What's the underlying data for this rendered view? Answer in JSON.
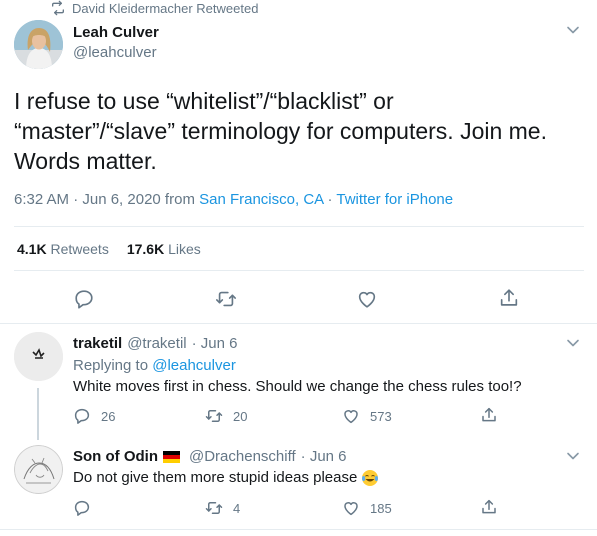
{
  "retweet_header": {
    "text": "David Kleidermacher Retweeted",
    "icon": "retweet-icon"
  },
  "main_tweet": {
    "author_name": "Leah Culver",
    "author_handle": "@leahculver",
    "text_lines": [
      "I refuse to use “whitelist”/“blacklist” or",
      "“master”/“slave” terminology for computers. Join me.",
      "Words matter."
    ],
    "time": "6:32 AM · Jun 6, 2020",
    "from_word": " from ",
    "location": "San Francisco, CA",
    "sep": " · ",
    "source": "Twitter for iPhone",
    "retweets_count": "4.1K",
    "retweets_label": " Retweets",
    "likes_count": "17.6K",
    "likes_label": " Likes",
    "actions": [
      "reply-icon",
      "retweet-icon",
      "like-icon",
      "share-icon"
    ]
  },
  "replies": [
    {
      "name": "traketil",
      "handle": "@traketil",
      "time": "· Jun 6",
      "replying_prefix": "Replying to ",
      "replying_to": "@leahculver",
      "text": "White moves first in chess. Should we change the chess rules too!?",
      "reply_count": "26",
      "retweet_count": "20",
      "like_count": "573"
    },
    {
      "name": "Son of Odin",
      "handle": "@Drachenschiff",
      "time": "· Jun 6",
      "text": "Do not give them more stupid ideas please",
      "reply_count": "",
      "retweet_count": "4",
      "like_count": "185",
      "flag": "germany-flag",
      "emoji": "tears-of-joy-emoji"
    }
  ],
  "colors": {
    "accent": "#1b95e0",
    "secondary_text": "#657786",
    "divider": "#e6ecf0"
  }
}
